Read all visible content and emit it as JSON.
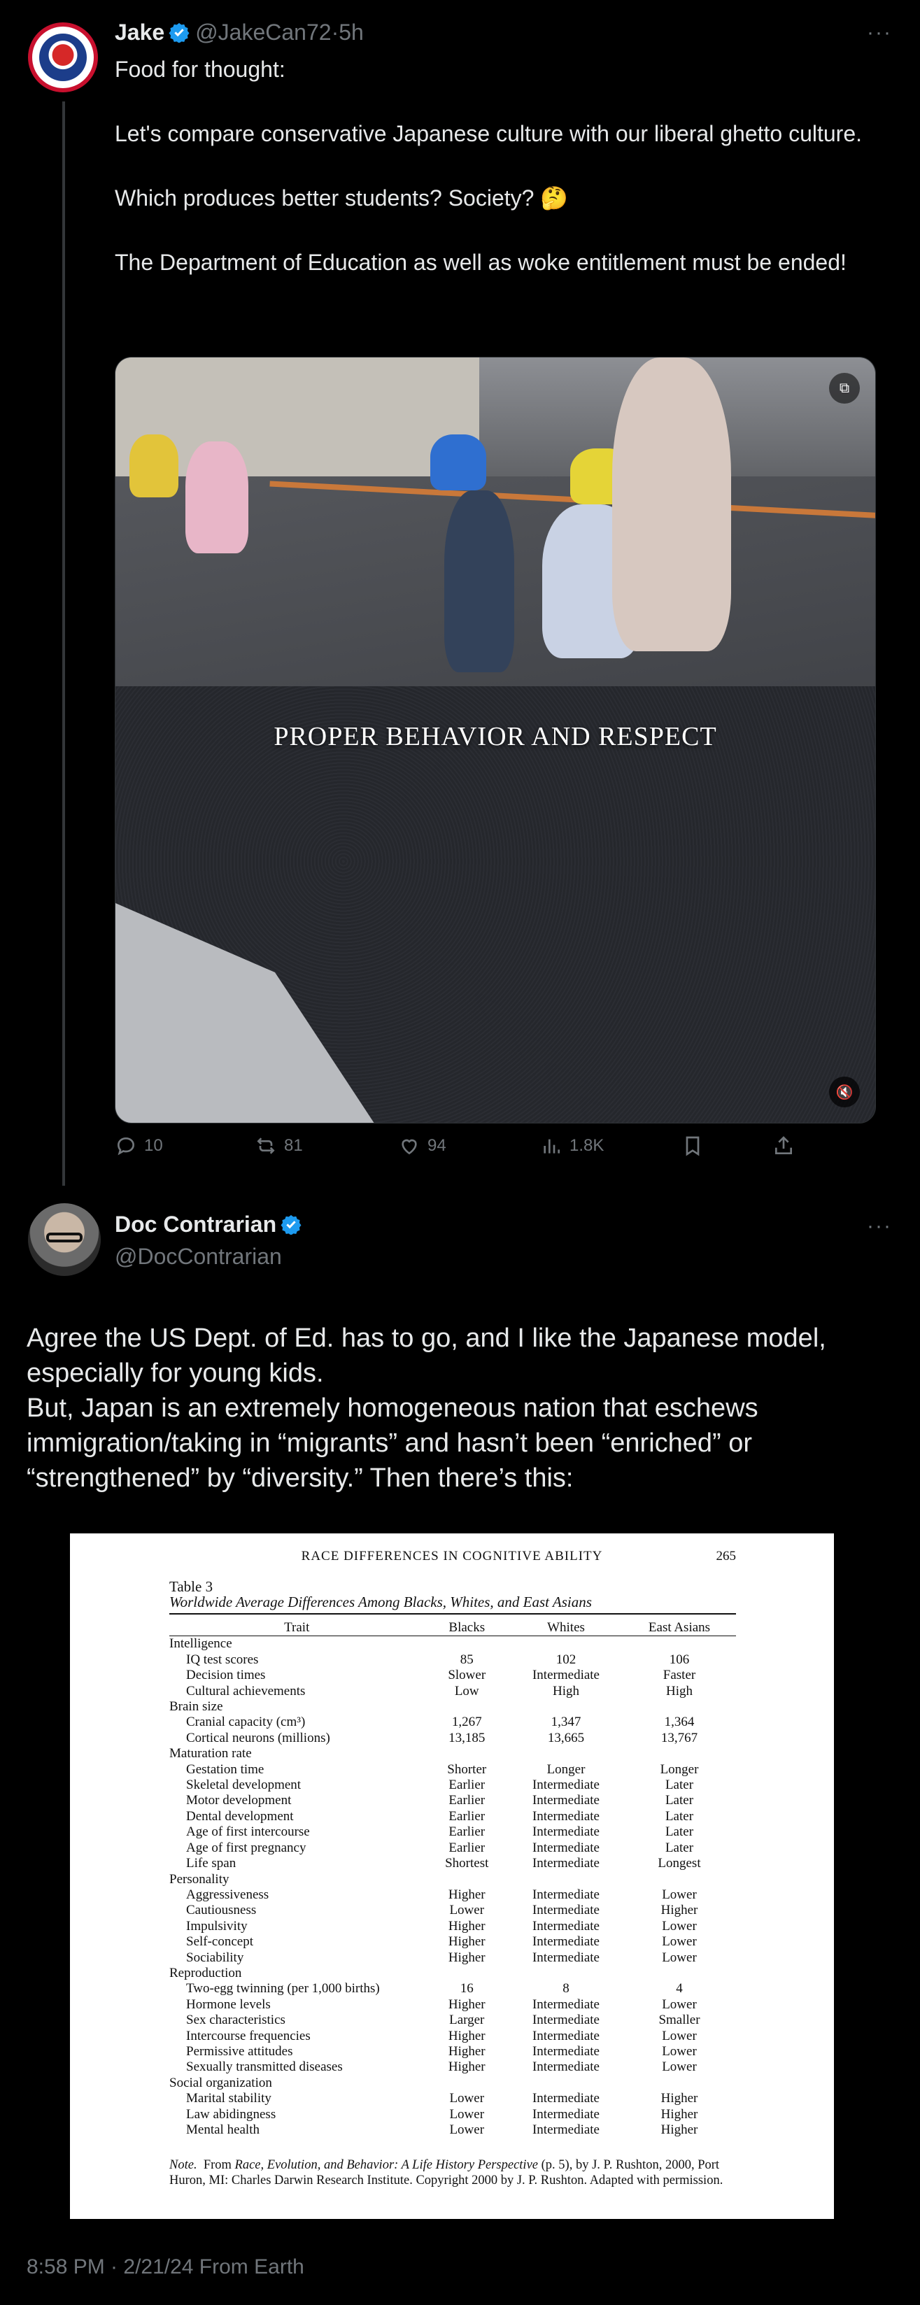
{
  "tweet1": {
    "name": "Jake",
    "handle": "@JakeCan72",
    "time_sep": "·",
    "time": "5h",
    "more": "···",
    "text": "Food for thought:\n\nLet's compare conservative Japanese culture with our liberal ghetto culture.\n\nWhich produces better students? Society? 🤔\n\nThe Department of Education as well as woke entitlement must be ended!",
    "video_caption": "PROPER BEHAVIOR AND RESPECT",
    "actions": {
      "replies": "10",
      "reposts": "81",
      "likes": "94",
      "views": "1.8K"
    }
  },
  "tweet2": {
    "name": "Doc Contrarian",
    "handle": "@DocContrarian",
    "more": "···",
    "text": "Agree the US Dept. of Ed. has to go, and I like the Japanese model, especially for young kids.\nBut, Japan is an extremely homogeneous nation that eschews immigration/taking in “migrants” and hasn’t been “enriched” or “strengthened” by “diversity.” Then there’s this:",
    "image": {
      "header": "RACE DIFFERENCES IN COGNITIVE ABILITY",
      "page": "265",
      "table_number": "Table 3",
      "table_title": "Worldwide Average Differences Among Blacks, Whites, and East Asians",
      "columns": [
        "Trait",
        "Blacks",
        "Whites",
        "East Asians"
      ],
      "rows": [
        {
          "trait": "Intelligence",
          "section": true,
          "b": "",
          "w": "",
          "e": ""
        },
        {
          "trait": "IQ test scores",
          "b": "85",
          "w": "102",
          "e": "106"
        },
        {
          "trait": "Decision times",
          "b": "Slower",
          "w": "Intermediate",
          "e": "Faster"
        },
        {
          "trait": "Cultural achievements",
          "b": "Low",
          "w": "High",
          "e": "High"
        },
        {
          "trait": "Brain size",
          "section": true,
          "b": "",
          "w": "",
          "e": ""
        },
        {
          "trait": "Cranial capacity (cm³)",
          "b": "1,267",
          "w": "1,347",
          "e": "1,364"
        },
        {
          "trait": "Cortical neurons (millions)",
          "b": "13,185",
          "w": "13,665",
          "e": "13,767"
        },
        {
          "trait": "Maturation rate",
          "section": true,
          "b": "",
          "w": "",
          "e": ""
        },
        {
          "trait": "Gestation time",
          "b": "Shorter",
          "w": "Longer",
          "e": "Longer"
        },
        {
          "trait": "Skeletal development",
          "b": "Earlier",
          "w": "Intermediate",
          "e": "Later"
        },
        {
          "trait": "Motor development",
          "b": "Earlier",
          "w": "Intermediate",
          "e": "Later"
        },
        {
          "trait": "Dental development",
          "b": "Earlier",
          "w": "Intermediate",
          "e": "Later"
        },
        {
          "trait": "Age of first intercourse",
          "b": "Earlier",
          "w": "Intermediate",
          "e": "Later"
        },
        {
          "trait": "Age of first pregnancy",
          "b": "Earlier",
          "w": "Intermediate",
          "e": "Later"
        },
        {
          "trait": "Life span",
          "b": "Shortest",
          "w": "Intermediate",
          "e": "Longest"
        },
        {
          "trait": "Personality",
          "section": true,
          "b": "",
          "w": "",
          "e": ""
        },
        {
          "trait": "Aggressiveness",
          "b": "Higher",
          "w": "Intermediate",
          "e": "Lower"
        },
        {
          "trait": "Cautiousness",
          "b": "Lower",
          "w": "Intermediate",
          "e": "Higher"
        },
        {
          "trait": "Impulsivity",
          "b": "Higher",
          "w": "Intermediate",
          "e": "Lower"
        },
        {
          "trait": "Self-concept",
          "b": "Higher",
          "w": "Intermediate",
          "e": "Lower"
        },
        {
          "trait": "Sociability",
          "b": "Higher",
          "w": "Intermediate",
          "e": "Lower"
        },
        {
          "trait": "Reproduction",
          "section": true,
          "b": "",
          "w": "",
          "e": ""
        },
        {
          "trait": "Two-egg twinning (per 1,000 births)",
          "b": "16",
          "w": "8",
          "e": "4"
        },
        {
          "trait": "Hormone levels",
          "b": "Higher",
          "w": "Intermediate",
          "e": "Lower"
        },
        {
          "trait": "Sex characteristics",
          "b": "Larger",
          "w": "Intermediate",
          "e": "Smaller"
        },
        {
          "trait": "Intercourse frequencies",
          "b": "Higher",
          "w": "Intermediate",
          "e": "Lower"
        },
        {
          "trait": "Permissive attitudes",
          "b": "Higher",
          "w": "Intermediate",
          "e": "Lower"
        },
        {
          "trait": "Sexually transmitted diseases",
          "b": "Higher",
          "w": "Intermediate",
          "e": "Lower"
        },
        {
          "trait": "Social organization",
          "section": true,
          "b": "",
          "w": "",
          "e": ""
        },
        {
          "trait": "Marital stability",
          "b": "Lower",
          "w": "Intermediate",
          "e": "Higher"
        },
        {
          "trait": "Law abidingness",
          "b": "Lower",
          "w": "Intermediate",
          "e": "Higher"
        },
        {
          "trait": "Mental health",
          "b": "Lower",
          "w": "Intermediate",
          "e": "Higher"
        }
      ],
      "note_label": "Note.",
      "note_pre": "From ",
      "note_title": "Race, Evolution, and Behavior: A Life History Perspective",
      "note_post": " (p. 5), by J. P. Rushton, 2000, Port Huron, MI: Charles Darwin Research Institute. Copyright 2000 by J. P. Rushton. Adapted with permission."
    },
    "timestamp": "8:58 PM · 2/21/24 From Earth"
  },
  "colors": {
    "background": "#000000",
    "text": "#e7e9ea",
    "muted": "#71767b",
    "verified": "#1d9bf0",
    "divider": "#333639"
  },
  "icons": [
    "verified-badge-icon",
    "more-icon",
    "reply-icon",
    "repost-icon",
    "like-icon",
    "views-icon",
    "bookmark-icon",
    "share-icon",
    "mute-icon",
    "pip-icon"
  ]
}
